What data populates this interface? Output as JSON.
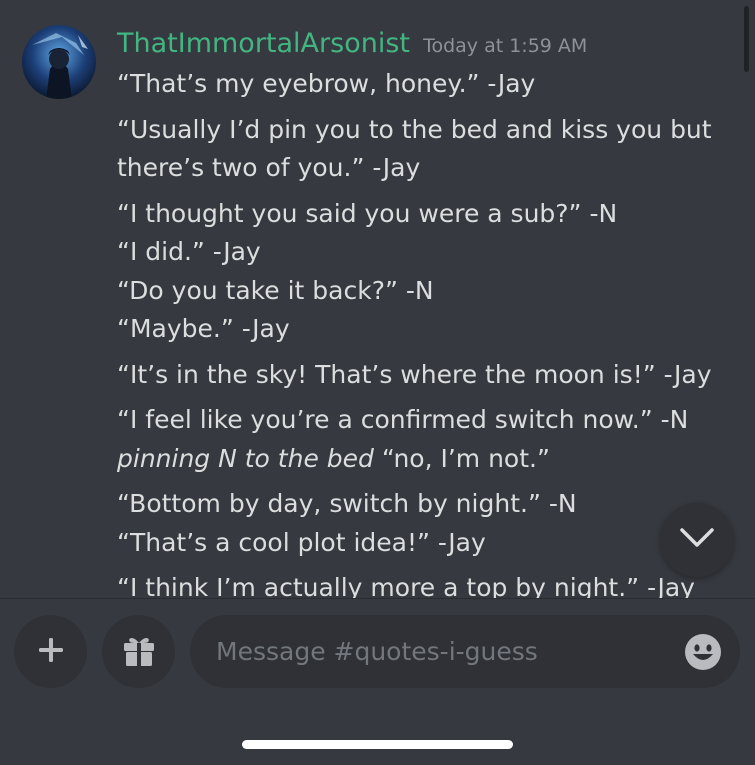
{
  "message": {
    "username": "ThatImmortalArsonist",
    "timestamp": "Today at 1:59 AM",
    "groups": [
      {
        "lines": [
          "“That’s my eyebrow, honey.” -Jay"
        ]
      },
      {
        "lines": [
          "“Usually I’d pin you to the bed and kiss  you but",
          "there’s two of you.” -Jay"
        ]
      },
      {
        "lines": [
          "“I thought you said you were a sub?” -N",
          "“I did.” -Jay",
          "“Do you take it back?” -N",
          "“Maybe.” -Jay"
        ]
      },
      {
        "lines": [
          "“It’s in the sky! That’s where the moon is!” -Jay"
        ]
      },
      {
        "lines": [
          "“I feel like you’re a confirmed switch now.” -N"
        ],
        "italic": "pinning N to the bed",
        "after_italic": " “no, I’m not.”"
      },
      {
        "lines": [
          "“Bottom by day, switch by night.” -N",
          "“That’s a cool plot idea!” -Jay"
        ]
      },
      {
        "lines": [
          "“I think I’m actually more a top by night.”  -Jay"
        ]
      }
    ]
  },
  "composer": {
    "placeholder": "Message #quotes-i-guess"
  },
  "icons": {
    "plus": "plus-icon",
    "gift": "gift-icon",
    "emoji": "smiley-icon",
    "jump": "chevron-down-icon"
  },
  "colors": {
    "background": "#36393f",
    "username": "#43b581",
    "input_bg": "#2f3136"
  }
}
